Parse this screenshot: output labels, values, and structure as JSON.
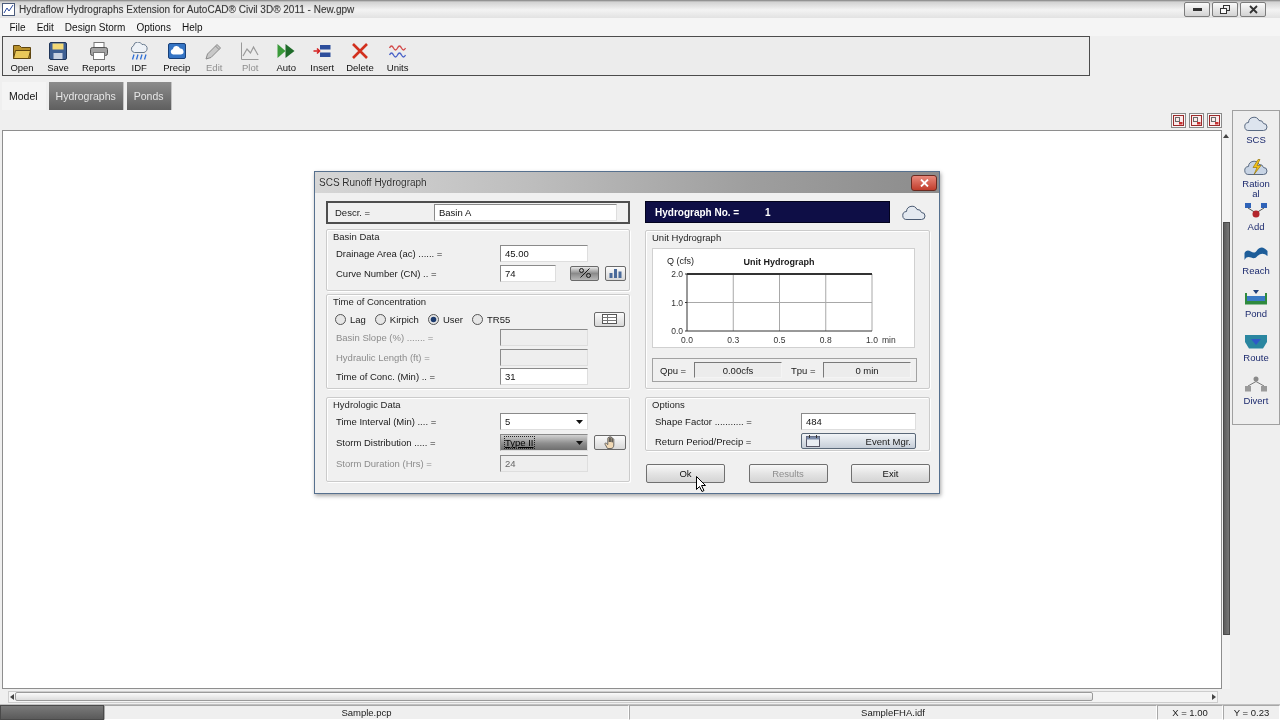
{
  "window": {
    "title": "Hydraflow Hydrographs Extension for AutoCAD® Civil 3D® 2011 - New.gpw"
  },
  "menu": [
    "File",
    "Edit",
    "Design Storm",
    "Options",
    "Help"
  ],
  "toolbar": [
    {
      "label": "Open",
      "kind": "open",
      "disabled": false
    },
    {
      "label": "Save",
      "kind": "save",
      "disabled": false
    },
    {
      "label": "Reports",
      "kind": "reports",
      "disabled": false
    },
    {
      "label": "IDF",
      "kind": "idf",
      "disabled": false
    },
    {
      "label": "Precip",
      "kind": "precip",
      "disabled": false
    },
    {
      "label": "Edit",
      "kind": "edit",
      "disabled": true
    },
    {
      "label": "Plot",
      "kind": "plot",
      "disabled": true
    },
    {
      "label": "Auto",
      "kind": "auto",
      "disabled": false
    },
    {
      "label": "Insert",
      "kind": "insert",
      "disabled": false
    },
    {
      "label": "Delete",
      "kind": "delete",
      "disabled": false
    },
    {
      "label": "Units",
      "kind": "units",
      "disabled": false
    }
  ],
  "tabs": [
    {
      "label": "Model",
      "selected": true
    },
    {
      "label": "Hydrographs",
      "selected": false
    },
    {
      "label": "Ponds",
      "selected": false
    }
  ],
  "dialog": {
    "title": "SCS Runoff Hydrograph",
    "descr": {
      "label": "Descr. =",
      "value": "Basin A"
    },
    "basin_data": {
      "title": "Basin Data",
      "fields": [
        {
          "label": "Drainage Area (ac) ...... =",
          "value": "45.00",
          "kind": "text",
          "disabled": false
        },
        {
          "label": "Curve Number (CN) .. =",
          "value": "74",
          "kind": "text",
          "disabled": false,
          "actions": [
            {
              "kind": "percent"
            },
            {
              "kind": "chart"
            }
          ]
        }
      ]
    },
    "time_of_concentration": {
      "title": "Time of Concentration",
      "methods": [
        {
          "label": "Lag",
          "selected": false
        },
        {
          "label": "Kirpich",
          "selected": false
        },
        {
          "label": "User",
          "selected": true
        },
        {
          "label": "TR55",
          "selected": false
        }
      ],
      "actions": [
        {
          "kind": "table"
        }
      ],
      "fields": [
        {
          "label": "Basin Slope (%) ....... =",
          "kind": "text",
          "disabled": true
        },
        {
          "label": "Hydraulic Length (ft) =",
          "kind": "text",
          "disabled": true
        },
        {
          "label": "Time of Conc. (Min) .. =",
          "value": "31",
          "kind": "text",
          "disabled": false
        }
      ]
    },
    "hydrologic_data": {
      "title": "Hydrologic Data",
      "fields": [
        {
          "label": "Time Interval (Min) .... =",
          "value": "5",
          "kind": "dropdown",
          "disabled": false,
          "focused": false
        },
        {
          "label": "Storm Distribution ..... =",
          "value": "Type II",
          "kind": "dropdown",
          "disabled": false,
          "focused": true,
          "actions": [
            {
              "kind": "hand"
            }
          ]
        },
        {
          "label": "Storm Duration (Hrs) =",
          "value": "24",
          "kind": "text",
          "disabled": true,
          "focused": false
        }
      ]
    },
    "hydrograph_no": {
      "label": "Hydrograph No. =",
      "value": "1"
    },
    "unit_hydrograph": {
      "title": "Unit Hydrograph",
      "chart_data": {
        "type": "line",
        "title": "Unit Hydrograph",
        "ylabel": "Q (cfs)",
        "xlabel": "min",
        "xlim": [
          0,
          1
        ],
        "ylim": [
          0,
          2
        ],
        "grid": true,
        "xticks": [
          {
            "value": 0,
            "label": "0.0"
          },
          {
            "value": 0.25,
            "label": "0.3"
          },
          {
            "value": 0.5,
            "label": "0.5"
          },
          {
            "value": 0.75,
            "label": "0.8"
          },
          {
            "value": 1,
            "label": "1.0"
          }
        ],
        "yticks": [
          {
            "value": 0,
            "label": "0.0"
          },
          {
            "value": 1,
            "label": "1.0"
          },
          {
            "value": 2,
            "label": "2.0"
          }
        ]
      },
      "qpu": {
        "label": "Qpu =",
        "value": "0.00cfs"
      },
      "tpu": {
        "label": "Tpu =",
        "value": "0 min"
      }
    },
    "options": {
      "title": "Options",
      "fields": [
        {
          "label": "Shape Factor ........... =",
          "value": "484",
          "kind": "text"
        },
        {
          "label": "Return Period/Precip =",
          "value": "Event Mgr.",
          "kind": "button"
        }
      ]
    },
    "buttons": [
      {
        "label": "Ok",
        "disabled": false
      },
      {
        "label": "Results",
        "disabled": true
      },
      {
        "label": "Exit",
        "disabled": false
      }
    ]
  },
  "sidebar": [
    {
      "label": "SCS",
      "kind": "scs"
    },
    {
      "label": "Rational",
      "kind": "rational"
    },
    {
      "label": "Add",
      "kind": "add"
    },
    {
      "label": "Reach",
      "kind": "reach"
    },
    {
      "label": "Pond",
      "kind": "pond"
    },
    {
      "label": "Route",
      "kind": "route"
    },
    {
      "label": "Divert",
      "kind": "divert"
    }
  ],
  "status_bar": [
    "Sample.pcp",
    "SampleFHA.idf",
    "X = 1.00",
    "Y = 0.23"
  ]
}
